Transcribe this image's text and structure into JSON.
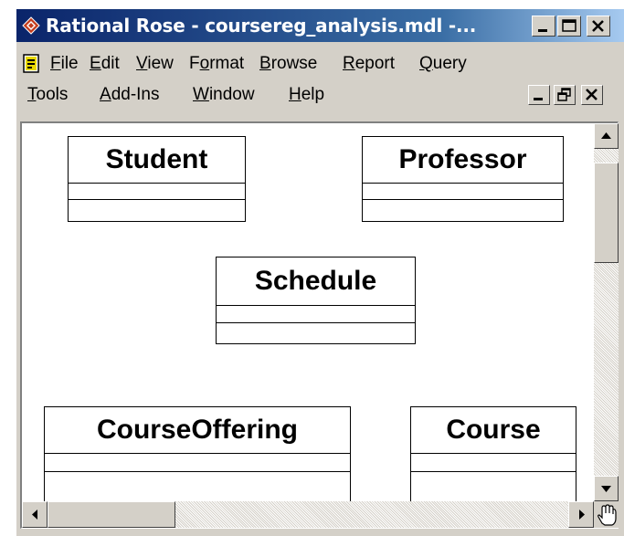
{
  "window": {
    "title": "Rational Rose - coursereg_analysis.mdl -...",
    "title_color": "#0a246a",
    "caption_buttons": [
      "minimize-icon",
      "maximize-icon",
      "close-icon"
    ]
  },
  "menubar": {
    "row1": [
      {
        "label": "File",
        "accel": "F",
        "rest": "ile"
      },
      {
        "label": "Edit",
        "accel": "E",
        "rest": "dit"
      },
      {
        "label": "View",
        "accel": "V",
        "rest": "iew"
      },
      {
        "label": "Format",
        "pre": "F",
        "accel": "o",
        "rest": "rmat"
      },
      {
        "label": "Browse",
        "accel": "B",
        "rest": "rowse"
      },
      {
        "label": "Report",
        "accel": "R",
        "rest": "eport"
      },
      {
        "label": "Query",
        "accel": "Q",
        "rest": "uery"
      }
    ],
    "row2": [
      {
        "label": "Tools",
        "accel": "T",
        "rest": "ools"
      },
      {
        "label": "Add-Ins",
        "accel": "A",
        "rest": "dd-Ins"
      },
      {
        "label": "Window",
        "accel": "W",
        "rest": "indow"
      },
      {
        "label": "Help",
        "accel": "H",
        "rest": "elp"
      }
    ],
    "document_buttons": [
      "minimize-icon",
      "restore-icon",
      "close-icon"
    ]
  },
  "diagram": {
    "classes": [
      {
        "name": "Student"
      },
      {
        "name": "Professor"
      },
      {
        "name": "Schedule"
      },
      {
        "name": "CourseOffering"
      },
      {
        "name": "Course"
      }
    ]
  },
  "scrollbars": {
    "vertical": {
      "up": "scroll-up-arrow-icon",
      "down": "scroll-down-arrow-icon"
    },
    "horizontal": {
      "left": "scroll-left-arrow-icon",
      "right": "scroll-right-arrow-icon"
    },
    "corner_icon": "hand-cursor-icon"
  }
}
